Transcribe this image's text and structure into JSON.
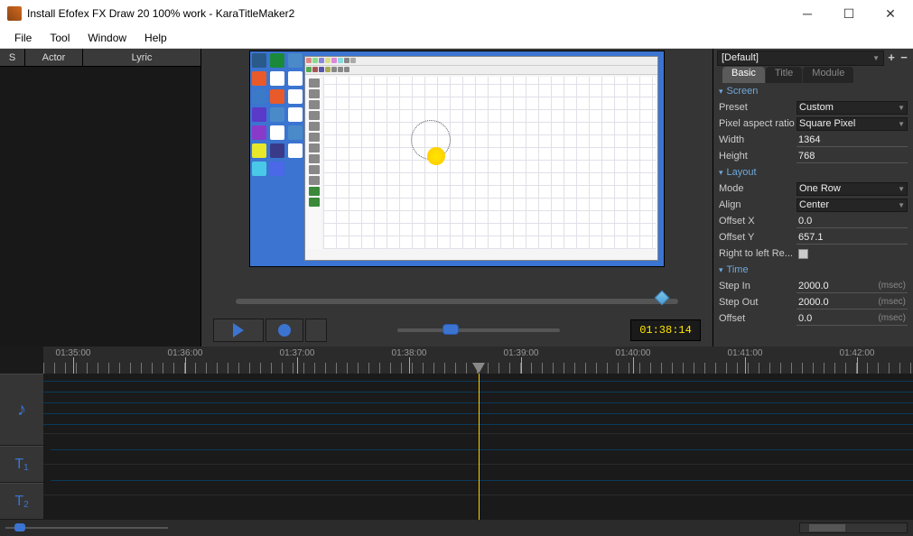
{
  "window": {
    "title": "Install Efofex FX Draw 20 100% work - KaraTitleMaker2"
  },
  "menu": {
    "file": "File",
    "tool": "Tool",
    "window": "Window",
    "help": "Help"
  },
  "left": {
    "s": "S",
    "actor": "Actor",
    "lyric": "Lyric"
  },
  "playback": {
    "timecode": "01:38:14"
  },
  "right": {
    "preset": "[Default]",
    "tabs": {
      "basic": "Basic",
      "title": "Title",
      "module": "Module"
    },
    "sections": {
      "screen": "Screen",
      "layout": "Layout",
      "time": "Time"
    },
    "screen": {
      "preset_label": "Preset",
      "preset_value": "Custom",
      "par_label": "Pixel aspect ratio",
      "par_value": "Square Pixel",
      "width_label": "Width",
      "width_value": "1364",
      "height_label": "Height",
      "height_value": "768"
    },
    "layout": {
      "mode_label": "Mode",
      "mode_value": "One Row",
      "align_label": "Align",
      "align_value": "Center",
      "offsetx_label": "Offset X",
      "offsetx_value": "0.0",
      "offsety_label": "Offset Y",
      "offsety_value": "657.1",
      "rtl_label": "Right to left Re..."
    },
    "time": {
      "stepin_label": "Step In",
      "stepin_value": "2000.0",
      "stepout_label": "Step Out",
      "stepout_value": "2000.0",
      "offset_label": "Offset",
      "offset_value": "0.0",
      "unit": "(msec)"
    }
  },
  "timeline": {
    "marks": [
      "01:35:00",
      "01:36:00",
      "01:37:00",
      "01:38:00",
      "01:39:00",
      "01:40:00",
      "01:41:00",
      "01:42:00"
    ],
    "playhead_pct": 53.5,
    "tracks": {
      "t1": "T",
      "t1sub": "1",
      "t2": "T",
      "t2sub": "2"
    }
  }
}
